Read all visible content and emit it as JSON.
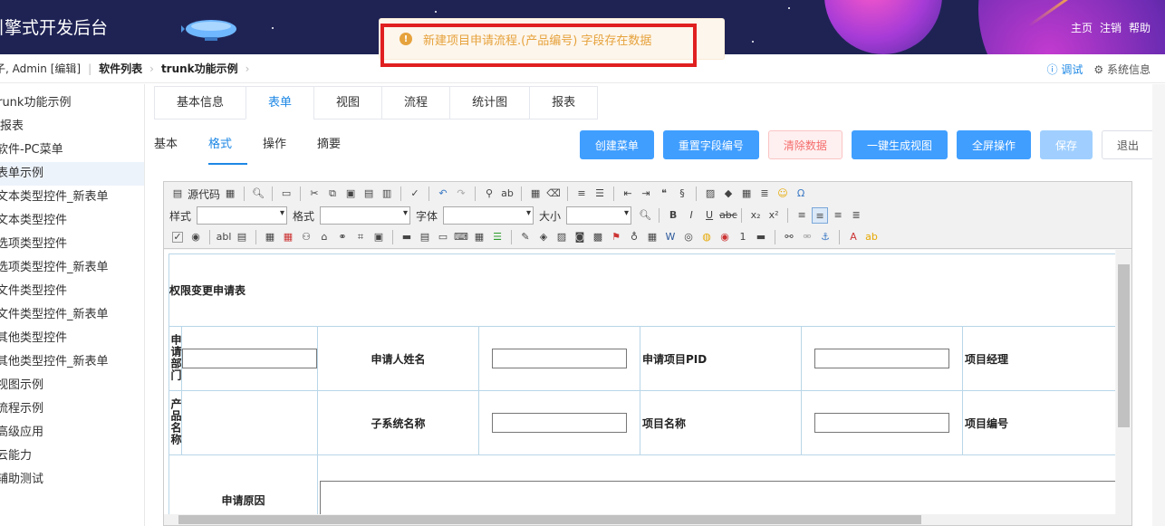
{
  "header": {
    "title": "引擎式开发后台",
    "links": [
      "主页",
      "注销",
      "帮助"
    ]
  },
  "toast": {
    "message": "新建项目申请流程.(产品编号) 字段存在数据"
  },
  "breadcrumb": {
    "user": "子, Admin [编辑]",
    "items": [
      "软件列表",
      "trunk功能示例"
    ],
    "right": {
      "debug": "调试",
      "system": "系统信息"
    }
  },
  "sidebar": {
    "items": [
      "trunk功能示例",
      "报表",
      "软件-PC菜单",
      "表单示例",
      "文本类型控件_新表单",
      "文本类型控件",
      "选项类型控件",
      "选项类型控件_新表单",
      "文件类型控件",
      "文件类型控件_新表单",
      "其他类型控件",
      "其他类型控件_新表单",
      "视图示例",
      "流程示例",
      "高级应用",
      "云能力",
      "辅助测试"
    ],
    "active_index": 3
  },
  "tabs": [
    "基本信息",
    "表单",
    "视图",
    "流程",
    "统计图",
    "报表"
  ],
  "active_tab": 1,
  "subtabs": [
    "基本",
    "格式",
    "操作",
    "摘要"
  ],
  "active_subtab": 1,
  "actions": {
    "create_menu": "创建菜单",
    "reset_fields": "重置字段编号",
    "clear_data": "清除数据",
    "gen_view": "一键生成视图",
    "fullscreen": "全屏操作",
    "save": "保存",
    "exit": "退出"
  },
  "toolbar": {
    "source": "源代码",
    "style_label": "样式",
    "format_label": "格式",
    "font_label": "字体",
    "size_label": "大小"
  },
  "form": {
    "title": "权限变更申请表",
    "row1": {
      "col1": "申请部门",
      "col3": "申请人姓名",
      "col5": "申请项目PID",
      "col7": "项目经理"
    },
    "row2": {
      "col1": "产品名称",
      "col3": "子系统名称",
      "col5": "项目名称",
      "col7": "项目编号"
    },
    "row3": {
      "col1": "申请原因"
    }
  }
}
